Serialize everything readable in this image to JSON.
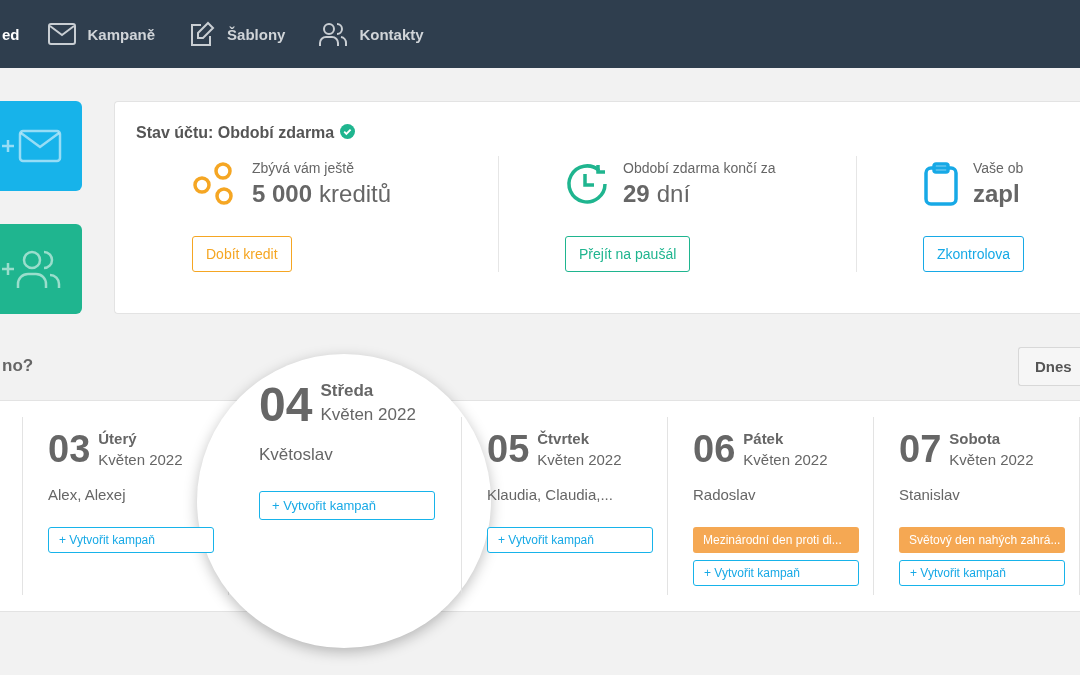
{
  "nav": {
    "cut_item": "ed",
    "items": [
      {
        "kind": "mail",
        "label": "Kampaně"
      },
      {
        "kind": "edit",
        "label": "Šablony"
      },
      {
        "kind": "contacts",
        "label": "Kontakty"
      }
    ]
  },
  "tiles": [
    {
      "kind": "mail",
      "color": "#17b3ea"
    },
    {
      "kind": "contacts",
      "color": "#1fb58f"
    }
  ],
  "account": {
    "title": "Stav účtu: Období zdarma",
    "verified": true,
    "stats": [
      {
        "kind": "credits",
        "label": "Zbývá vám ještě",
        "value_bold": "5 000",
        "value_rest": "kreditů",
        "button": "Dobít kredit"
      },
      {
        "kind": "time",
        "label": "Období zdarma končí za",
        "value_bold": "29",
        "value_rest": "dní",
        "button": "Přejít na paušál"
      },
      {
        "kind": "check",
        "label": "Vaše ob",
        "value_bold": "zapl",
        "button": "Zkontrolova"
      }
    ]
  },
  "schedule": {
    "heading": "no?",
    "today_button": "Dnes",
    "days": [
      {
        "day": "03",
        "weekday": "Úterý",
        "month": "Květen 2022",
        "names": "Alex, Alexej",
        "magnified": false,
        "button": "+ Vytvořit kampaň"
      },
      {
        "day": "04",
        "weekday": "Středa",
        "month": "Květen 2022",
        "names": "Květoslav",
        "magnified": true,
        "button": "+ Vytvořit kampaň"
      },
      {
        "day": "05",
        "weekday": "Čtvrtek",
        "month": "Květen 2022",
        "names": "Klaudia, Claudia,...",
        "magnified": false,
        "button": "+ Vytvořit kampaň"
      },
      {
        "day": "06",
        "weekday": "Pátek",
        "month": "Květen 2022",
        "names": "Radoslav",
        "magnified": false,
        "events": [
          "Mezinárodní den proti di..."
        ],
        "button": "+ Vytvořit kampaň"
      },
      {
        "day": "07",
        "weekday": "Sobota",
        "month": "Květen 2022",
        "names": "Stanislav",
        "magnified": false,
        "events": [
          "Světový den nahých zahrá..."
        ],
        "button": "+ Vytvořit kampaň"
      }
    ]
  }
}
